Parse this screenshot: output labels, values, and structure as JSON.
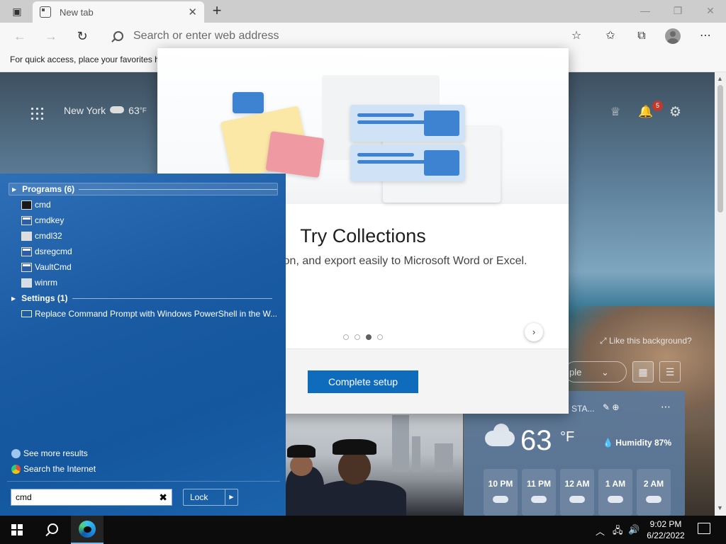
{
  "browser": {
    "tab_title": "New tab",
    "address_placeholder": "Search or enter web address",
    "favorites_bar_text": "For quick access, place your favorites h"
  },
  "ntp": {
    "location": "New York",
    "temperature": "63",
    "temp_unit": "°F",
    "notification_count": "5",
    "like_background": "Like this background?",
    "feed_label": "ple"
  },
  "weather_card": {
    "location": "STA...",
    "temperature": "63",
    "unit": "°F",
    "humidity": "Humidity 87%",
    "hours": [
      {
        "label": "10 PM",
        "icon": "cloud-icon"
      },
      {
        "label": "11 PM",
        "icon": "cloud-icon"
      },
      {
        "label": "12 AM",
        "icon": "rain-cloud-icon"
      },
      {
        "label": "1 AM",
        "icon": "rain-cloud-icon"
      },
      {
        "label": "2 AM",
        "icon": "rain-cloud-icon"
      }
    ]
  },
  "dialog": {
    "title": "Try Collections",
    "body": "d share information, and export easily to Microsoft Word or Excel.",
    "dots": 4,
    "active_dot": 3,
    "cta": "Complete setup"
  },
  "start_menu": {
    "programs_header": "Programs (6)",
    "programs": [
      {
        "label": "cmd",
        "icon": "console-icon"
      },
      {
        "label": "cmdkey",
        "icon": "properties-icon"
      },
      {
        "label": "cmdl32",
        "icon": "gear-sheet-icon"
      },
      {
        "label": "dsregcmd",
        "icon": "properties-icon"
      },
      {
        "label": "VaultCmd",
        "icon": "properties-icon"
      },
      {
        "label": "winrm",
        "icon": "script-icon"
      }
    ],
    "settings_header": "Settings (1)",
    "settings": [
      {
        "label": "Replace Command Prompt with Windows PowerShell in the W...",
        "icon": "monitor-icon"
      }
    ],
    "see_more": "See more results",
    "search_internet": "Search the Internet",
    "search_value": "cmd",
    "lock_label": "Lock"
  },
  "taskbar": {
    "time": "9:02 PM",
    "date": "6/22/2022"
  },
  "colors": {
    "accent": "#0f6cbd",
    "start_menu_blue": "#1a5ba4",
    "badge_red": "#c0392b"
  }
}
